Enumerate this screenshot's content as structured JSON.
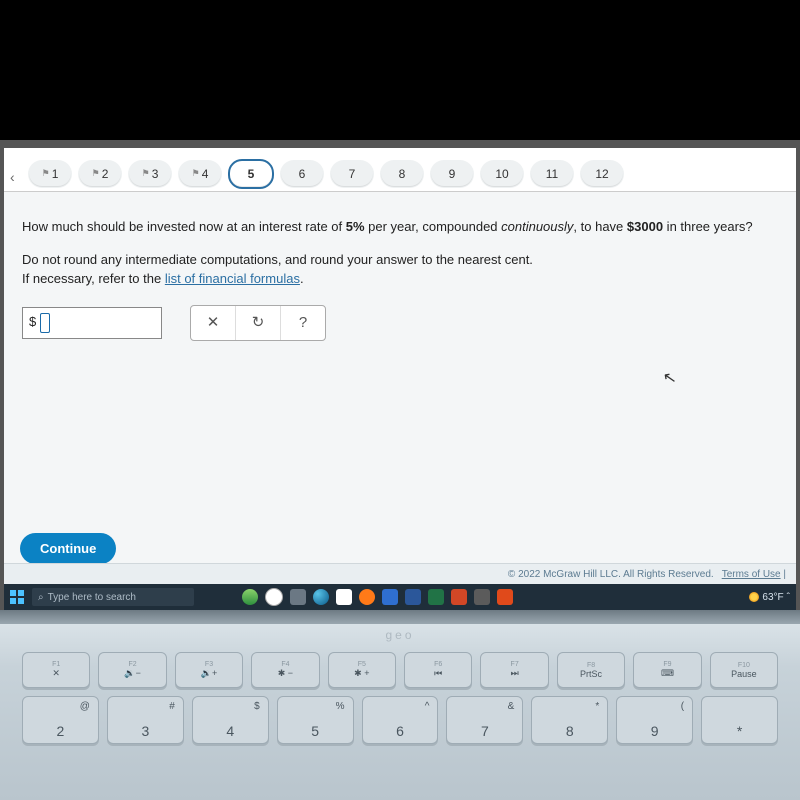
{
  "nav": {
    "items": [
      {
        "label": "1",
        "flagged": true
      },
      {
        "label": "2",
        "flagged": true
      },
      {
        "label": "3",
        "flagged": true
      },
      {
        "label": "4",
        "flagged": true
      },
      {
        "label": "5",
        "current": true
      },
      {
        "label": "6"
      },
      {
        "label": "7"
      },
      {
        "label": "8"
      },
      {
        "label": "9"
      },
      {
        "label": "10"
      },
      {
        "label": "11"
      },
      {
        "label": "12"
      }
    ]
  },
  "question": {
    "line1_pre": "How much should be invested now at an interest rate of ",
    "rate": "5%",
    "line1_mid": " per year, compounded ",
    "compounding": "continuously",
    "line1_mid2": ", to have ",
    "amount": "$3000",
    "line1_post": " in three years?",
    "line2a": "Do not round any intermediate computations, and round your answer to the nearest cent.",
    "line2b_pre": "If necessary, refer to the ",
    "link_text": "list of financial formulas",
    "line2b_post": "."
  },
  "answer": {
    "currency_symbol": "$",
    "value": ""
  },
  "tools": {
    "check": "✕",
    "reset": "↻",
    "help": "?"
  },
  "continue_label": "Continue",
  "footer": {
    "copyright": "© 2022 McGraw Hill LLC. All Rights Reserved.",
    "terms": "Terms of Use"
  },
  "taskbar": {
    "search_placeholder": "Type here to search",
    "temperature": "63°F"
  },
  "laptop": {
    "brand": "geo",
    "fn_keys": [
      {
        "top": "F1",
        "glyph": "✕"
      },
      {
        "top": "F2",
        "glyph": "🔉−"
      },
      {
        "top": "F3",
        "glyph": "🔉+"
      },
      {
        "top": "F4",
        "glyph": "✱ −"
      },
      {
        "top": "F5",
        "glyph": "✱ +"
      },
      {
        "top": "F6",
        "glyph": "⏮"
      },
      {
        "top": "F7",
        "glyph": "⏭"
      },
      {
        "top": "F8",
        "glyph": "PrtSc"
      },
      {
        "top": "F9",
        "glyph": "⌨"
      },
      {
        "top": "F10",
        "glyph": "Pause"
      }
    ],
    "num_keys": [
      {
        "sym": "@",
        "digit": "2"
      },
      {
        "sym": "#",
        "digit": "3"
      },
      {
        "sym": "$",
        "digit": "4"
      },
      {
        "sym": "%",
        "digit": "5"
      },
      {
        "sym": "^",
        "digit": "6"
      },
      {
        "sym": "&",
        "digit": "7"
      },
      {
        "sym": "*",
        "digit": "8"
      },
      {
        "sym": "(",
        "digit": "9"
      },
      {
        "sym": "",
        "digit": "*"
      }
    ]
  }
}
